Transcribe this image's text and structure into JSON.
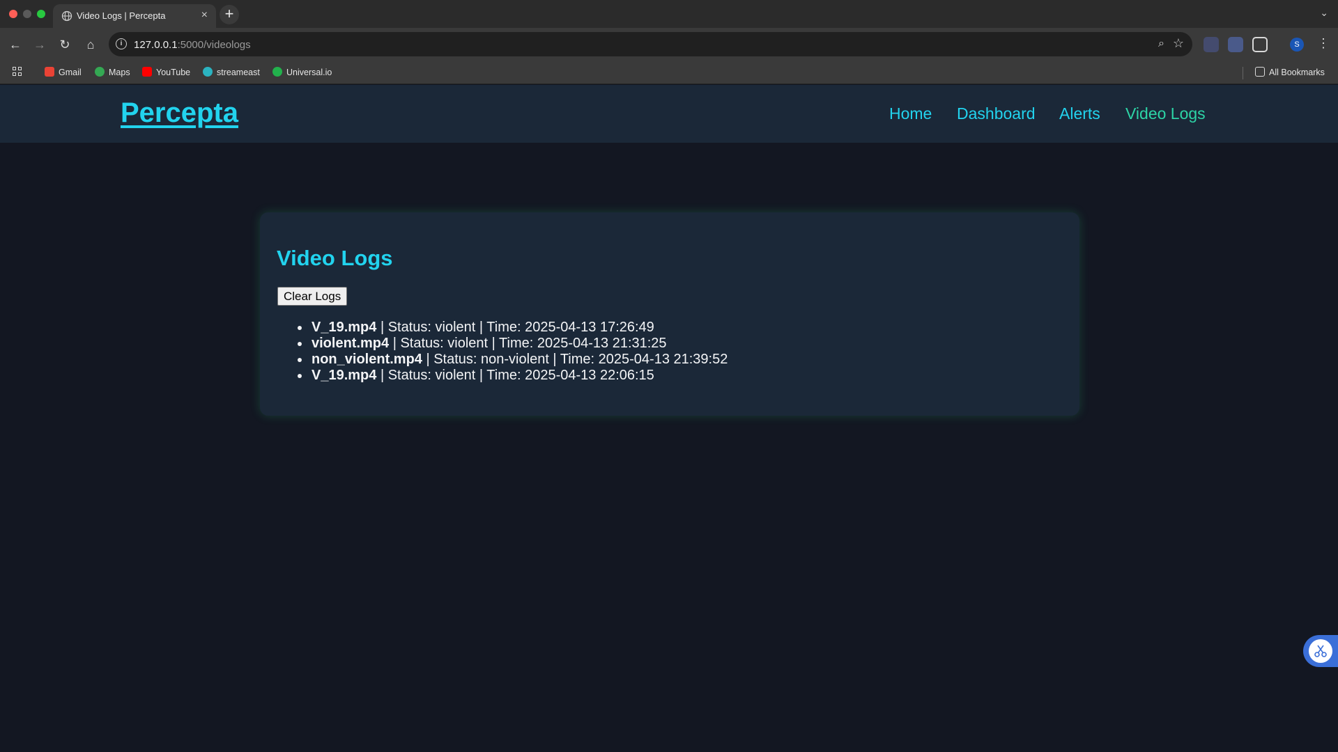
{
  "browser": {
    "tab": {
      "title": "Video Logs | Percepta",
      "close": "×"
    },
    "new_tab": "+",
    "address": {
      "host": "127.0.0.1",
      "path": ":5000/videologs"
    },
    "profile_initial": "S",
    "bookmarks": [
      {
        "label": "Gmail",
        "icon": "gmail-icon",
        "color": "#ea4335"
      },
      {
        "label": "Maps",
        "icon": "maps-icon",
        "color": "#34a853"
      },
      {
        "label": "YouTube",
        "icon": "youtube-icon",
        "color": "#ff0000"
      },
      {
        "label": "streameast",
        "icon": "streameast-icon",
        "color": "#2bb3c0"
      },
      {
        "label": "Universal.io",
        "icon": "universal-icon",
        "color": "#22b14c"
      }
    ],
    "all_bookmarks": "All Bookmarks"
  },
  "header": {
    "logo": "Percepta",
    "nav": [
      "Home",
      "Dashboard",
      "Alerts",
      "Video Logs"
    ]
  },
  "main": {
    "title": "Video Logs",
    "clear_button": "Clear Logs",
    "logs": [
      {
        "file": "V_19.mp4",
        "detail": " | Status: violent | Time: 2025-04-13 17:26:49"
      },
      {
        "file": "violent.mp4",
        "detail": " | Status: violent | Time: 2025-04-13 21:31:25"
      },
      {
        "file": "non_violent.mp4",
        "detail": " | Status: non-violent | Time: 2025-04-13 21:39:52"
      },
      {
        "file": "V_19.mp4",
        "detail": " | Status: violent | Time: 2025-04-13 22:06:15"
      }
    ]
  },
  "colors": {
    "accent": "#22d3ee",
    "active_nav": "#2dd4a6",
    "page_bg": "#131722",
    "card_bg": "#1b2838"
  }
}
